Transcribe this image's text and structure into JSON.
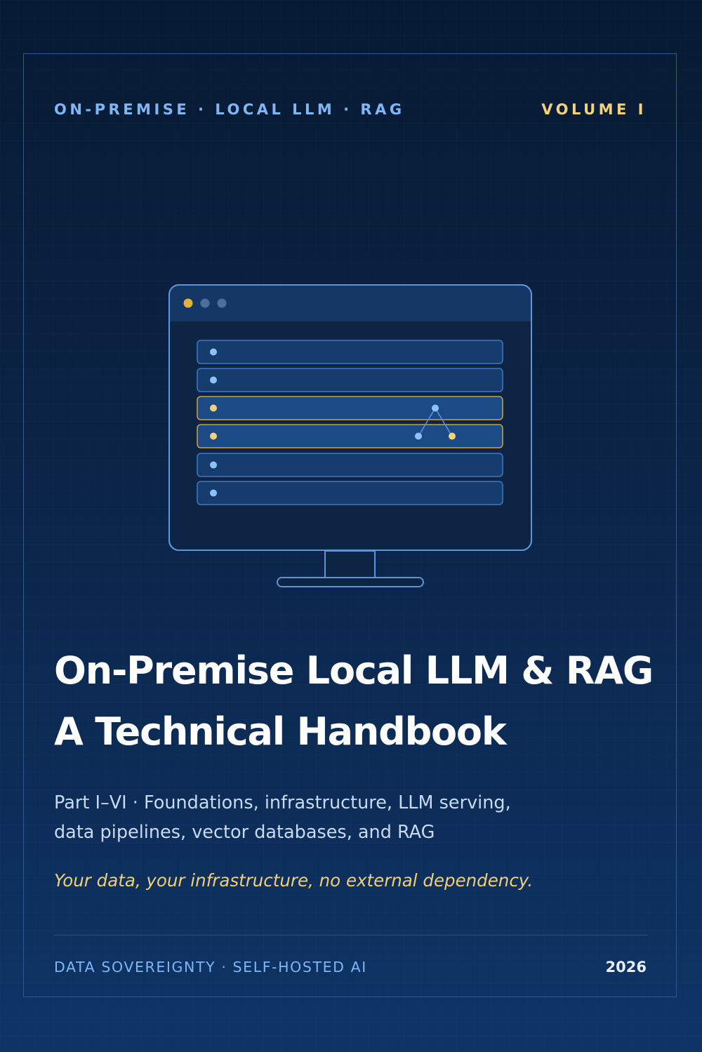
{
  "cover": {
    "series_line": "ON-PREMISE · LOCAL LLM · RAG",
    "volume": "VOLUME I",
    "title_line_1": "On-Premise Local LLM & RAG",
    "title_line_2": "A Technical Handbook",
    "subtitle_line_1": "Part I–VI · Foundations, infrastructure, LLM serving,",
    "subtitle_line_2": "data pipelines, vector databases, and RAG",
    "tagline": "Your data, your infrastructure, no external dependency.",
    "footer_left": "DATA SOVEREIGNTY · SELF-HOSTED AI",
    "footer_right": "2026"
  },
  "illustration": {
    "icon": "monitor-icon",
    "row_count": 6,
    "highlighted_rows": [
      3,
      4
    ]
  },
  "colors": {
    "background_top": "#071a33",
    "background_bottom": "#0e3466",
    "frame": "#2f5a8f",
    "accent_blue": "#7fb6f5",
    "accent_gold": "#f2d27a",
    "title": "#ffffff"
  }
}
